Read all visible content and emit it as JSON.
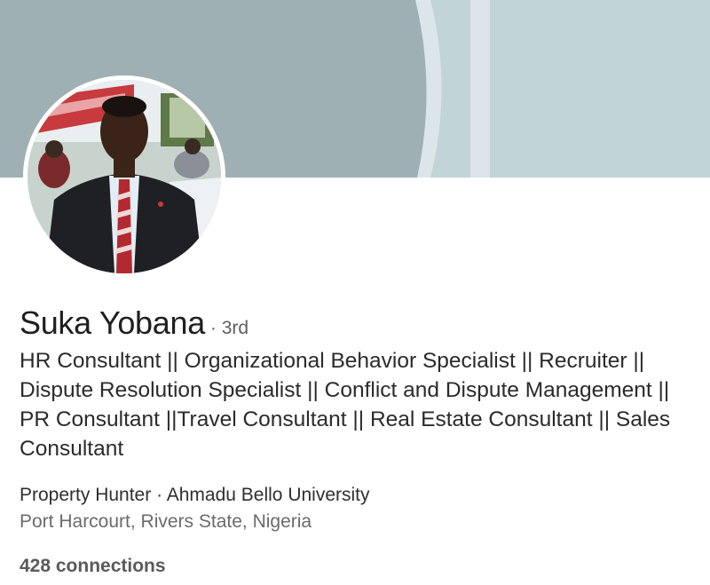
{
  "profile": {
    "name": "Suka Yobana",
    "degree": "· 3rd",
    "headline": "HR Consultant || Organizational Behavior Specialist || Recruiter || Dispute Resolution Specialist || Conflict and Dispute Management || PR Consultant ||Travel Consultant || Real Estate Consultant || Sales Consultant",
    "company_school": "Property Hunter · Ahmadu Bello University",
    "location": "Port Harcourt, Rivers State, Nigeria",
    "connections": "428 connections"
  },
  "cover": {
    "colors": {
      "dark": "#9eb0b4",
      "stripe": "#dce6e8",
      "light": "#c1d4d8"
    }
  },
  "avatar": {
    "icon": "profile-photo"
  }
}
